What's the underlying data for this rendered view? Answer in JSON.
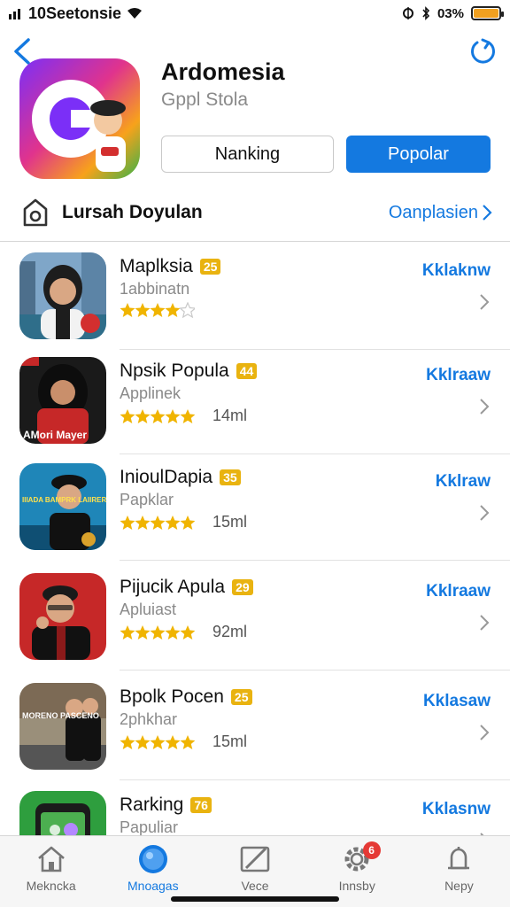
{
  "status_bar": {
    "carrier": "10Seetonsie",
    "battery_text": "03%"
  },
  "header": {
    "app_title": "Ardomesia",
    "app_subtitle": "Gppl Stola",
    "button_secondary": "Nanking",
    "button_primary": "Popolar"
  },
  "section": {
    "title": "Lursah Doyulan",
    "link": "Oanplasien"
  },
  "apps": [
    {
      "name": "Maplksia",
      "badge": "25",
      "category": "1abbinatn",
      "rating": 4.5,
      "size": "",
      "action": "Kklaknw"
    },
    {
      "name": "Npsik Popula",
      "badge": "44",
      "category": "Applinek",
      "rating": 5,
      "size": "14ml",
      "action": "Kklraaw"
    },
    {
      "name": "InioulDapia",
      "badge": "35",
      "category": "Papklar",
      "rating": 5,
      "size": "15ml",
      "action": "Kklraw"
    },
    {
      "name": "Pijucik Apula",
      "badge": "29",
      "category": "Apluiast",
      "rating": 5,
      "size": "92ml",
      "action": "Kklraaw"
    },
    {
      "name": "Bpolk Pocen",
      "badge": "25",
      "category": "2phkhar",
      "rating": 5,
      "size": "15ml",
      "action": "Kklasaw"
    },
    {
      "name": "Rarking",
      "badge": "76",
      "category": "Papuliar",
      "rating": 5,
      "size": "",
      "action": "Kklasnw"
    }
  ],
  "thumb_texts": {
    "app2": "AMori Mayer",
    "app3": "IIIADA BAMPRK LAIIRER",
    "app5": "MORENO PASCENO"
  },
  "tabs": [
    {
      "label": "Mekncka",
      "icon": "home-icon"
    },
    {
      "label": "Mnoagas",
      "icon": "globe-icon"
    },
    {
      "label": "Vece",
      "icon": "edit-icon"
    },
    {
      "label": "Innsby",
      "icon": "gear-icon",
      "badge": "6"
    },
    {
      "label": "Nepy",
      "icon": "bell-icon"
    }
  ],
  "colors": {
    "accent": "#1479e0",
    "badge": "#e9b310",
    "star": "#f0b400"
  }
}
